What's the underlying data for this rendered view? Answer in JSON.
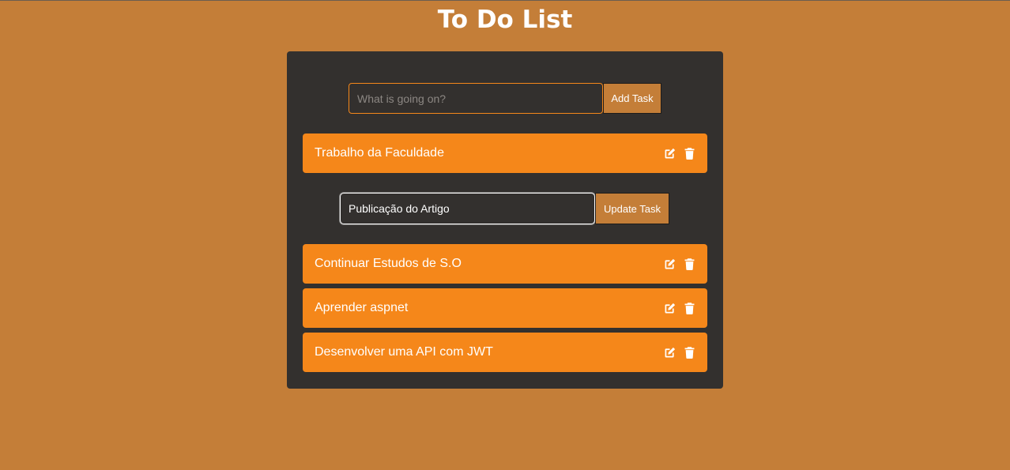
{
  "header": {
    "title": "To Do List"
  },
  "add_form": {
    "placeholder": "What is going on?",
    "value": "",
    "button_label": "Add Task"
  },
  "edit_form": {
    "value": "Publicação do Artigo",
    "button_label": "Update Task"
  },
  "tasks": [
    {
      "label": "Trabalho da Faculdade",
      "edit_icon": "edit-icon",
      "delete_icon": "trash-icon"
    },
    {
      "label": "Continuar Estudos de S.O",
      "edit_icon": "edit-icon",
      "delete_icon": "trash-icon"
    },
    {
      "label": "Aprender aspnet",
      "edit_icon": "edit-icon",
      "delete_icon": "trash-icon"
    },
    {
      "label": "Desenvolver uma API com JWT",
      "edit_icon": "edit-icon",
      "delete_icon": "trash-icon"
    }
  ],
  "colors": {
    "background": "#c47e38",
    "panel": "#33302e",
    "task": "#f5871a",
    "text": "#ffffff"
  }
}
